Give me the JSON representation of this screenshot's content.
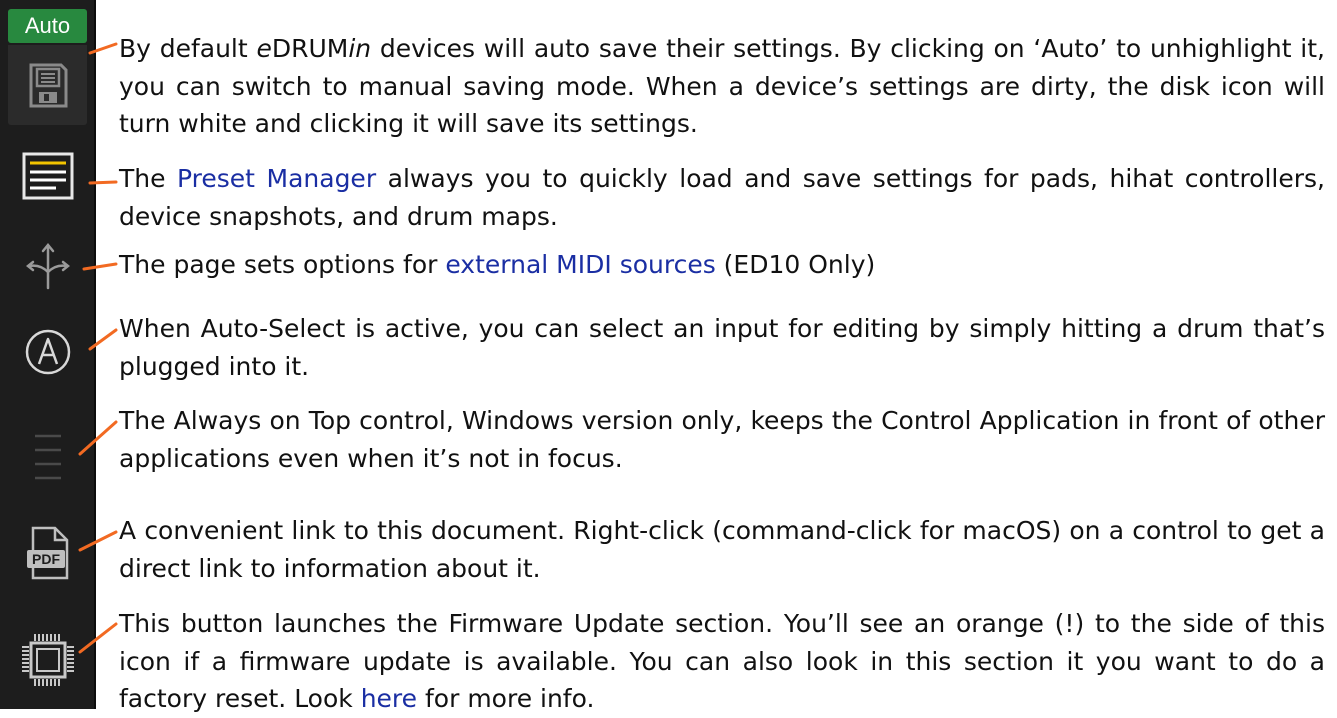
{
  "sidebar": {
    "auto_label": "Auto",
    "icons": [
      "floppy-disk-icon",
      "preset-manager-icon",
      "midi-sources-icon",
      "auto-select-icon",
      "always-on-top-icon",
      "pdf-icon",
      "chip-icon"
    ],
    "pdf_label": "PDF"
  },
  "colors": {
    "sidebar_bg": "#1d1d1d",
    "auto_active": "#28893f",
    "callout_line": "#f26a22",
    "link": "#1a2ea3",
    "preset_accent": "#f2c400"
  },
  "paragraphs": {
    "p1": {
      "prefix_e": "e",
      "brand": "DRUM",
      "brand_suffix": "in",
      "text": " devices will auto save their settings.  By clicking on ‘Auto’ to unhighlight it, you can switch to manual saving mode.  When a device’s settings are dirty, the disk icon will turn white and clicking it will save its settings.",
      "lead": "By default "
    },
    "p2": {
      "lead": "The ",
      "link": "Preset Manager",
      "text": " always you to quickly load and save settings for pads, hihat controllers, device snapshots, and drum maps."
    },
    "p3": {
      "lead": "The page sets options for ",
      "link": "external MIDI sources",
      "text": " (ED10 Only)"
    },
    "p4": {
      "text": "When Auto-Select is active, you can select an input for editing by simply hitting a drum that’s plugged into it."
    },
    "p5": {
      "text": "The Always on Top control, Windows version only, keeps the Control Application in front of other applications even when it’s not in focus."
    },
    "p6": {
      "text": "A convenient link to this document. Right-click (command-click for macOS) on a control to get a direct link to information about it."
    },
    "p7": {
      "lead": "This button launches the Firmware Update section.  You’ll see an orange (!) to the side of this icon if a firmware update is available.  You can also look in this section it you want to do a factory reset.  Look ",
      "link": "here",
      "text": " for more info."
    }
  }
}
